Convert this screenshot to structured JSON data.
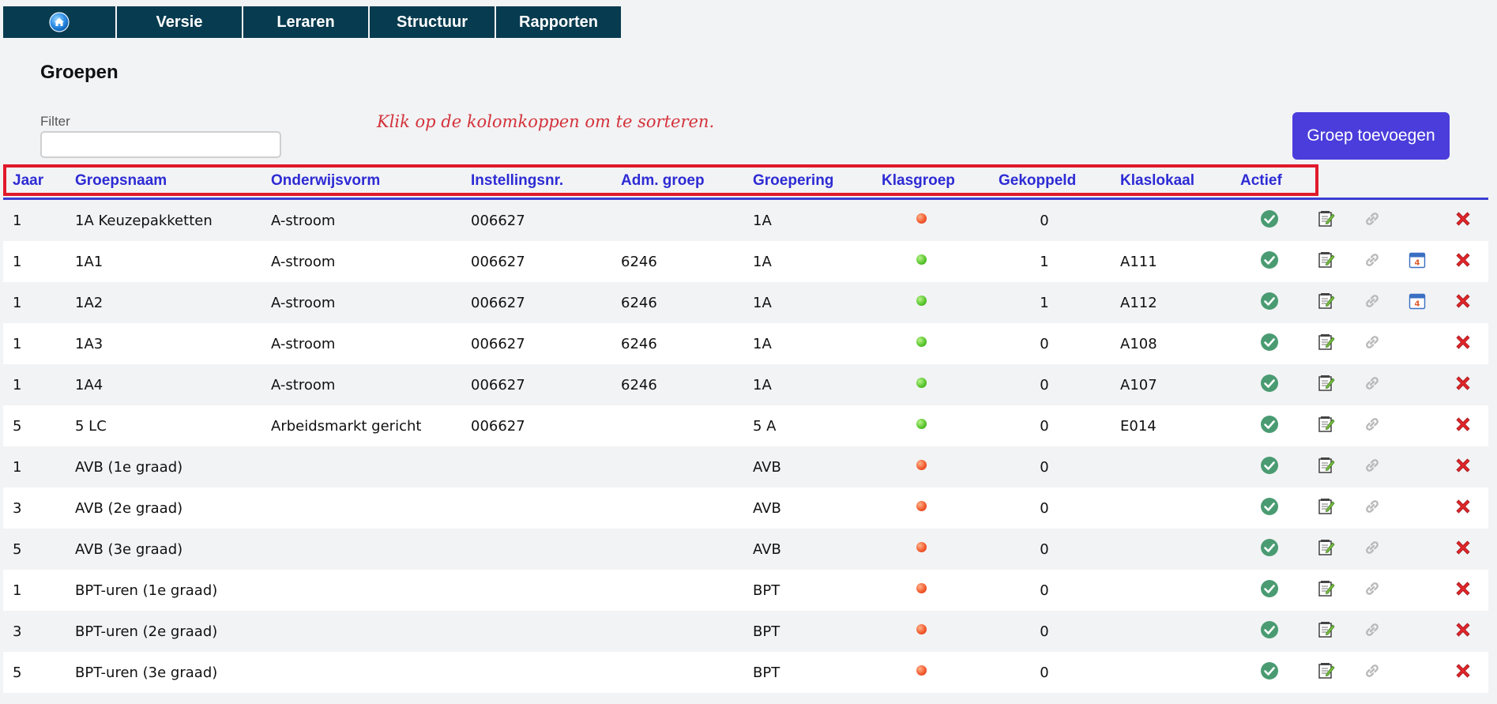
{
  "nav": {
    "home_icon": "home-icon",
    "items": [
      {
        "label": "Versie"
      },
      {
        "label": "Leraren"
      },
      {
        "label": "Structuur"
      },
      {
        "label": "Rapporten"
      }
    ]
  },
  "page": {
    "title": "Groepen",
    "filter_label": "Filter",
    "filter_value": "",
    "hint": "Klik op de kolomkoppen om te sorteren.",
    "add_button": "Groep toevoegen"
  },
  "colors": {
    "nav_bg": "#073b4f",
    "header_link": "#2d2bd4",
    "button_bg": "#4a3ddb",
    "highlight_border": "#e01a2b",
    "hint_text": "#d3323a"
  },
  "table": {
    "headers": {
      "jaar": "Jaar",
      "groepsnaam": "Groepsnaam",
      "onderwijsvorm": "Onderwijsvorm",
      "instellingsnr": "Instellingsnr.",
      "adm_groep": "Adm. groep",
      "groepering": "Groepering",
      "klasgroep": "Klasgroep",
      "gekoppeld": "Gekoppeld",
      "klaslokaal": "Klaslokaal",
      "actief": "Actief"
    },
    "rows": [
      {
        "jaar": "1",
        "naam": "1A Keuzepakketten",
        "ow": "A-stroom",
        "inst": "006627",
        "adm": "",
        "groep": "1A",
        "klas": "red",
        "gek": "0",
        "lok": "",
        "cal": false
      },
      {
        "jaar": "1",
        "naam": "1A1",
        "ow": "A-stroom",
        "inst": "006627",
        "adm": "6246",
        "groep": "1A",
        "klas": "green",
        "gek": "1",
        "lok": "A111",
        "cal": true
      },
      {
        "jaar": "1",
        "naam": "1A2",
        "ow": "A-stroom",
        "inst": "006627",
        "adm": "6246",
        "groep": "1A",
        "klas": "green",
        "gek": "1",
        "lok": "A112",
        "cal": true
      },
      {
        "jaar": "1",
        "naam": "1A3",
        "ow": "A-stroom",
        "inst": "006627",
        "adm": "6246",
        "groep": "1A",
        "klas": "green",
        "gek": "0",
        "lok": "A108",
        "cal": false
      },
      {
        "jaar": "1",
        "naam": "1A4",
        "ow": "A-stroom",
        "inst": "006627",
        "adm": "6246",
        "groep": "1A",
        "klas": "green",
        "gek": "0",
        "lok": "A107",
        "cal": false
      },
      {
        "jaar": "5",
        "naam": "5 LC",
        "ow": "Arbeidsmarkt gericht",
        "inst": "006627",
        "adm": "",
        "groep": "5 A",
        "klas": "green",
        "gek": "0",
        "lok": "E014",
        "cal": false
      },
      {
        "jaar": "1",
        "naam": "AVB (1e graad)",
        "ow": "",
        "inst": "",
        "adm": "",
        "groep": "AVB",
        "klas": "red",
        "gek": "0",
        "lok": "",
        "cal": false
      },
      {
        "jaar": "3",
        "naam": "AVB (2e graad)",
        "ow": "",
        "inst": "",
        "adm": "",
        "groep": "AVB",
        "klas": "red",
        "gek": "0",
        "lok": "",
        "cal": false
      },
      {
        "jaar": "5",
        "naam": "AVB (3e graad)",
        "ow": "",
        "inst": "",
        "adm": "",
        "groep": "AVB",
        "klas": "red",
        "gek": "0",
        "lok": "",
        "cal": false
      },
      {
        "jaar": "1",
        "naam": "BPT-uren (1e graad)",
        "ow": "",
        "inst": "",
        "adm": "",
        "groep": "BPT",
        "klas": "red",
        "gek": "0",
        "lok": "",
        "cal": false
      },
      {
        "jaar": "3",
        "naam": "BPT-uren (2e graad)",
        "ow": "",
        "inst": "",
        "adm": "",
        "groep": "BPT",
        "klas": "red",
        "gek": "0",
        "lok": "",
        "cal": false
      },
      {
        "jaar": "5",
        "naam": "BPT-uren (3e graad)",
        "ow": "",
        "inst": "",
        "adm": "",
        "groep": "BPT",
        "klas": "red",
        "gek": "0",
        "lok": "",
        "cal": false
      }
    ],
    "row_icons": {
      "active": "check-circle-icon",
      "edit": "edit-notepad-icon",
      "link": "link-icon",
      "calendar": "calendar-icon",
      "delete": "delete-x-icon"
    }
  }
}
